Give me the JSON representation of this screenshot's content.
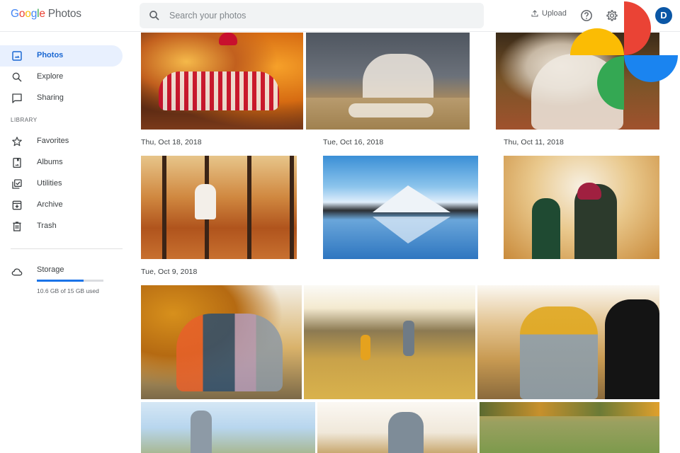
{
  "app": {
    "logo_letters": [
      "G",
      "o",
      "o",
      "g",
      "l",
      "e"
    ],
    "product": "Photos"
  },
  "search": {
    "placeholder": "Search your photos",
    "value": ""
  },
  "header": {
    "upload_label": "Upload",
    "avatar_initial": "D"
  },
  "sidebar": {
    "items": [
      {
        "label": "Photos",
        "icon": "photo-icon",
        "active": true
      },
      {
        "label": "Explore",
        "icon": "search-icon"
      },
      {
        "label": "Sharing",
        "icon": "chat-icon"
      }
    ],
    "library_heading": "LIBRARY",
    "library_items": [
      {
        "label": "Favorites",
        "icon": "star-icon"
      },
      {
        "label": "Albums",
        "icon": "album-icon"
      },
      {
        "label": "Utilities",
        "icon": "utilities-icon"
      },
      {
        "label": "Archive",
        "icon": "archive-icon"
      },
      {
        "label": "Trash",
        "icon": "trash-icon"
      }
    ],
    "storage": {
      "label": "Storage",
      "used_fraction": 0.707,
      "text": "10.6 GB of 15 GB used"
    }
  },
  "groups": [
    {
      "date": "Thu, Oct 18, 2018",
      "photos": [
        "Family in striped pajamas by Christmas tree"
      ]
    },
    {
      "date": "Tue, Oct 16, 2018",
      "photos": [
        "Mother and daughters baking cookies in kitchen"
      ]
    },
    {
      "date": "Thu, Oct 11, 2018",
      "photos": [
        "Girl and mother in autumn forest"
      ]
    },
    {
      "date": "Tue, Oct 9, 2018",
      "photos": [
        "Mother and child walking in autumn leaves",
        "Mountain lake reflection",
        "Girls playing with autumn leaves"
      ]
    },
    {
      "date": "",
      "photos": [
        "Family sitting on picnic blanket",
        "Family walking on hill with dog",
        "Family petting black dog",
        "Father and family walking",
        "Couple walking on hill",
        "Family in autumn meadow"
      ]
    }
  ],
  "colors": {
    "accent": "#1a73e8",
    "active_bg": "#e8f0fe",
    "pinwheel_red": "#ea4335",
    "pinwheel_yellow": "#fbbc04",
    "pinwheel_green": "#34a853",
    "pinwheel_blue": "#4285f4"
  }
}
